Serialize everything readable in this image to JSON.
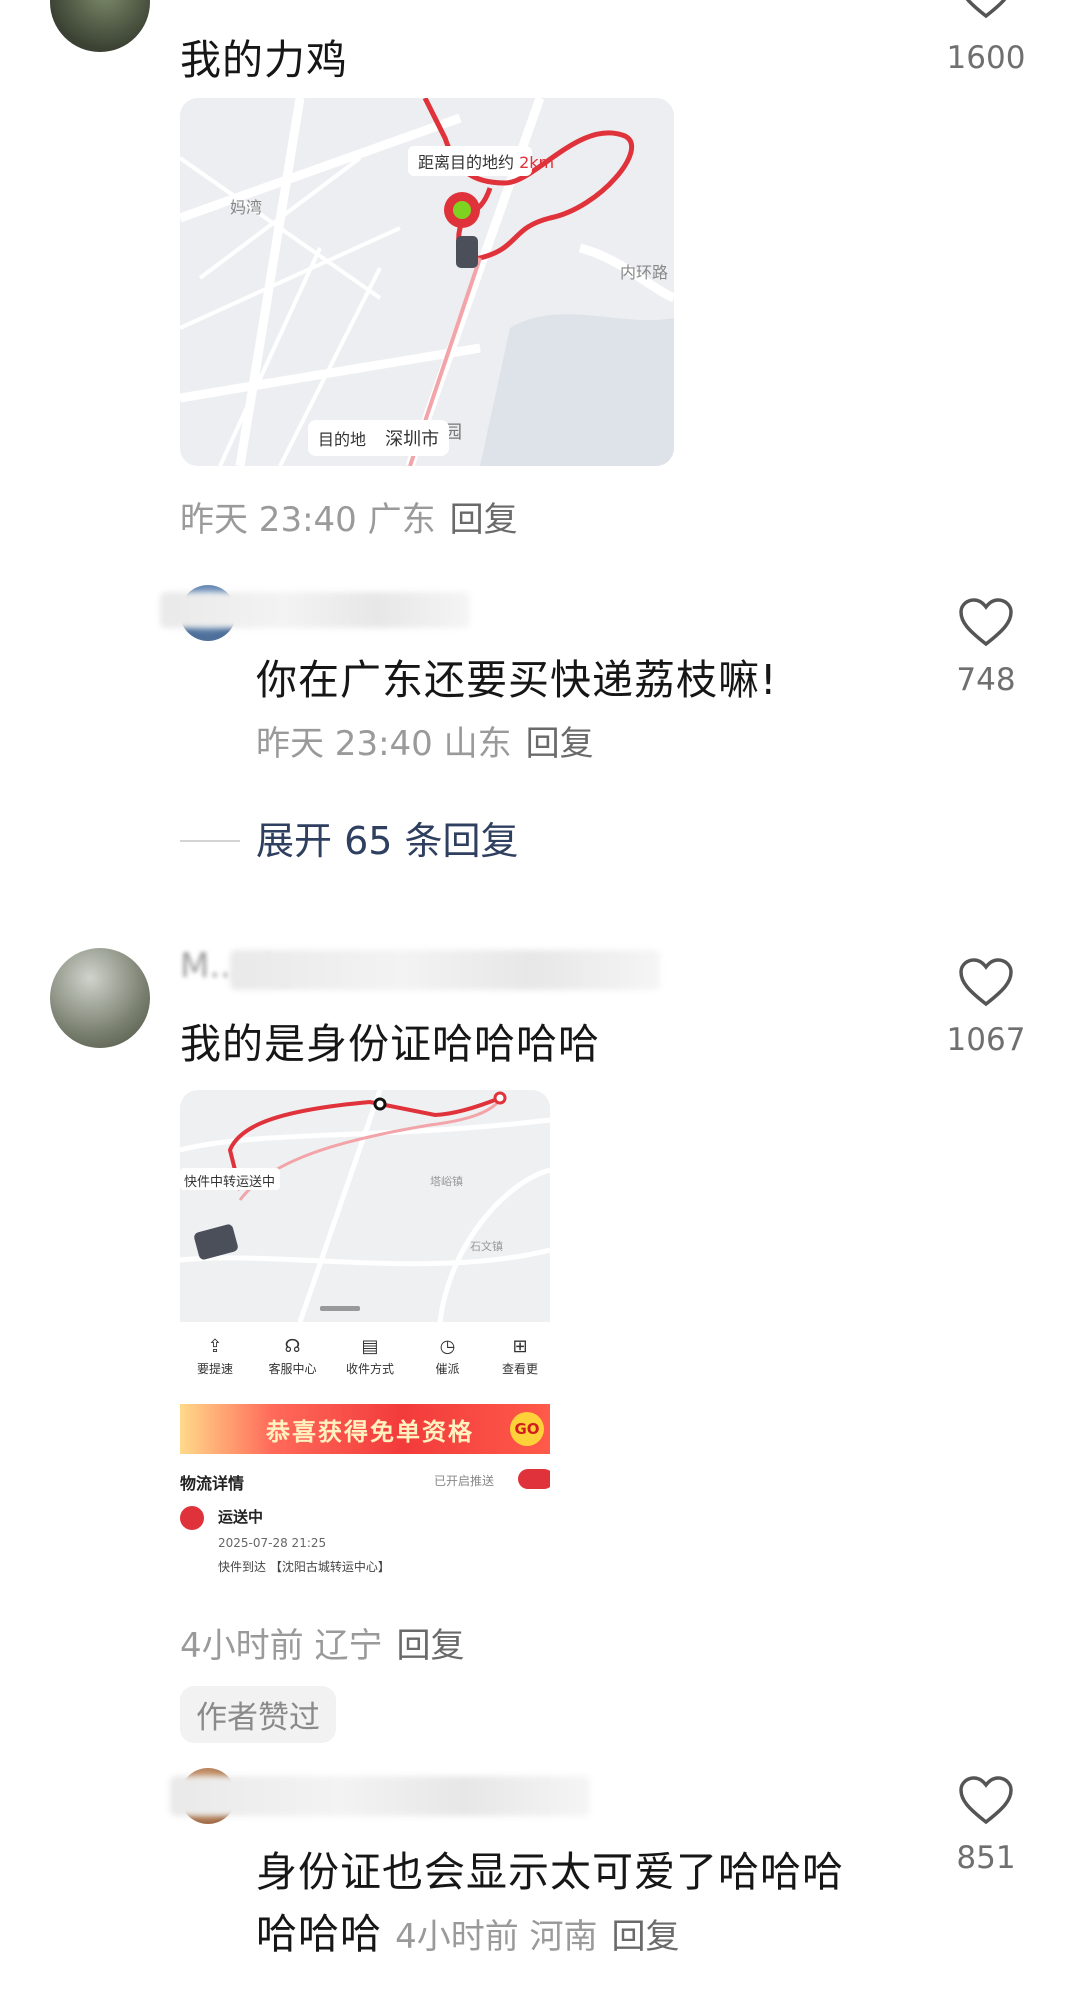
{
  "comments": [
    {
      "text": "我的力鸡",
      "time": "昨天 23:40",
      "location": "广东",
      "reply_label": "回复",
      "likes": "1600",
      "image": {
        "distance_label": "距离目的地约",
        "distance_value": "2km",
        "dest_label": "目的地",
        "dest_city": "深圳市",
        "places": [
          "铁路公园",
          "妈湾",
          "内环路"
        ]
      },
      "replies": [
        {
          "username": "好消息来啦",
          "text": "你在广东还要买快递荔枝嘛!",
          "time": "昨天 23:40",
          "location": "山东",
          "reply_label": "回复",
          "likes": "748"
        }
      ],
      "expand_label": "展开 65 条回复"
    },
    {
      "username": "M...at_",
      "text": "我的是身份证哈哈哈哈",
      "time": "4小时前",
      "location": "辽宁",
      "reply_label": "回复",
      "likes": "1067",
      "author_badge": "作者赞过",
      "image": {
        "status_bubble": "快件中转运送中",
        "places": [
          "塔峪镇",
          "石文镇"
        ],
        "actions": [
          "要提速",
          "客服中心",
          "收件方式",
          "催派",
          "查看更"
        ],
        "banner": "恭喜获得免单资格",
        "banner_go": "GO",
        "logistics_title": "物流详情",
        "push_label": "已开启推送",
        "status": "运送中",
        "datetime": "2025-07-28 21:25",
        "detail": "快件到达 【沈阳古城转运中心】"
      },
      "replies": [
        {
          "username": "饿的时候不饿",
          "text_line1": "身份证也会显示太可爱了哈哈哈",
          "text_line2": "哈哈哈",
          "time": "4小时前",
          "location": "河南",
          "reply_label": "回复",
          "likes": "851"
        }
      ]
    }
  ],
  "colors": {
    "route_red": "#e0323a",
    "link_blue": "#2f3f60",
    "meta_gray": "#9a9a9a"
  }
}
